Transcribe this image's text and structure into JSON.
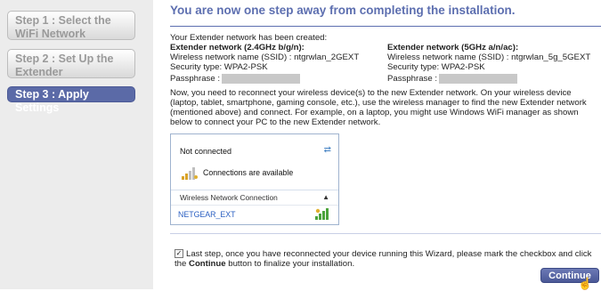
{
  "sidebar": {
    "steps": [
      {
        "label": "Step 1 : Select the WiFi Network",
        "state": "done"
      },
      {
        "label": "Step 2 : Set Up the Extender",
        "state": "done"
      },
      {
        "label": "Step 3 : Apply Settings",
        "state": "active"
      }
    ]
  },
  "main": {
    "headline": "You are now one step away from completing the installation.",
    "created_text": "Your Extender network has been created:",
    "net24": {
      "title": "Extender network (2.4GHz b/g/n):",
      "ssid": "Wireless network name (SSID) :  ntgrwlan_2GEXT",
      "security": "Security type: WPA2-PSK",
      "passphrase_label": "Passphrase :"
    },
    "net5": {
      "title": "Extender network (5GHz a/n/ac):",
      "ssid": "Wireless network name (SSID) :  ntgrwlan_5g_5GEXT",
      "security": "Security type: WPA2-PSK",
      "passphrase_label": "Passphrase :"
    },
    "instructions": "Now, you need to reconnect your wireless device(s) to the new Extender network. On your wireless device (laptop, tablet, smartphone, gaming console, etc.), use the wireless manager to find the new Extender network (mentioned above) and connect. For example, on a laptop, you might use Windows WiFi manager as shown below to connect your PC to the new Extender network.",
    "popup": {
      "status": "Not connected",
      "available": "Connections are available",
      "section": "Wireless Network Connection",
      "network": "NETGEAR_EXT"
    },
    "last_step": {
      "text_before": "Last step, once you have reconnected your device running this Wizard, please mark the checkbox and click the ",
      "continue_word": "Continue",
      "text_after": " button to finalize your installation.",
      "checked": true
    },
    "continue_label": "Continue"
  },
  "colors": {
    "accent": "#5d6fb0",
    "active_step": "#5b6aa7",
    "sidebar_bg": "#ececec"
  }
}
